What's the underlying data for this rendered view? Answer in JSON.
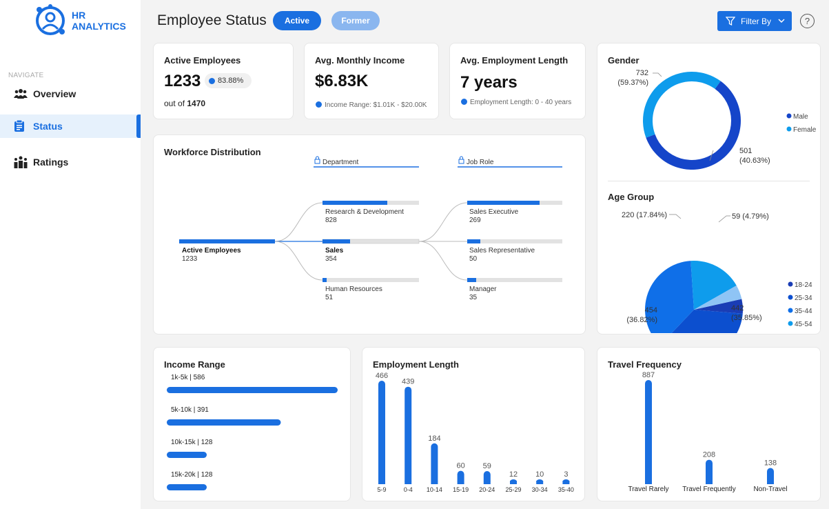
{
  "brand": {
    "line1": "HR",
    "line2": "ANALYTICS"
  },
  "nav": {
    "heading": "NAVIGATE",
    "items": [
      {
        "label": "Overview",
        "icon": "people-icon"
      },
      {
        "label": "Status",
        "icon": "clipboard-icon"
      },
      {
        "label": "Ratings",
        "icon": "award-icon"
      }
    ]
  },
  "header": {
    "title": "Employee Status",
    "active_label": "Active",
    "former_label": "Former",
    "filter_label": "Filter By",
    "help_label": "?"
  },
  "colors": {
    "accent": "#1a6fe0",
    "former_pill": "#8ab6ef",
    "light_blue": "#0e9cec"
  },
  "kpis": {
    "active": {
      "title": "Active Employees",
      "value": "1233",
      "percent": "83.88%",
      "out_of_label": "out of",
      "out_of_value": "1470"
    },
    "income": {
      "title": "Avg. Monthly Income",
      "value": "$6.83K",
      "note": "Income Range: $1.01K - $20.00K"
    },
    "tenure": {
      "title": "Avg. Employment Length",
      "value": "7 years",
      "note": "Employment Length: 0 - 40 years"
    }
  },
  "workforce": {
    "title": "Workforce Distribution",
    "root": {
      "label": "Active Employees",
      "value": "1233"
    },
    "level1_header": "Department",
    "level2_header": "Job Role",
    "departments": [
      {
        "label": "Research & Development",
        "value": "828",
        "bold": false
      },
      {
        "label": "Sales",
        "value": "354",
        "bold": true
      },
      {
        "label": "Human Resources",
        "value": "51",
        "bold": false
      }
    ],
    "roles": [
      {
        "label": "Sales Executive",
        "value": "269"
      },
      {
        "label": "Sales Representative",
        "value": "50"
      },
      {
        "label": "Manager",
        "value": "35"
      }
    ]
  },
  "gender": {
    "title": "Gender",
    "male_label": "732",
    "male_pct": "(59.37%)",
    "female_label": "501",
    "female_pct": "(40.63%)",
    "legend": [
      "Male",
      "Female"
    ]
  },
  "age_group": {
    "title": "Age Group",
    "legend": [
      "18-24",
      "25-34",
      "35-44",
      "45-54",
      "55-60"
    ],
    "labels": [
      {
        "a": "220 (17.84%)"
      },
      {
        "a": "59 (4.79%)"
      },
      {
        "a": "454",
        "b": "(36.82%)"
      },
      {
        "a": "442",
        "b": "(35.85%)"
      }
    ]
  },
  "income_range": {
    "title": "Income Range"
  },
  "employment_length": {
    "title": "Employment Length"
  },
  "travel": {
    "title": "Travel Frequency"
  },
  "chart_data": [
    {
      "type": "pie",
      "title": "Gender",
      "categories": [
        "Male",
        "Female"
      ],
      "values": [
        732,
        501
      ],
      "percent": [
        59.37,
        40.63
      ]
    },
    {
      "type": "pie",
      "title": "Age Group",
      "categories": [
        "18-24",
        "25-34",
        "35-44",
        "45-54",
        "55-60"
      ],
      "values": [
        59,
        442,
        454,
        220,
        58
      ]
    },
    {
      "type": "bar",
      "title": "Income Range",
      "categories": [
        "1k-5k",
        "5k-10k",
        "10k-15k",
        "15k-20k"
      ],
      "values": [
        586,
        391,
        128,
        128
      ]
    },
    {
      "type": "bar",
      "title": "Employment Length",
      "categories": [
        "5-9",
        "0-4",
        "10-14",
        "15-19",
        "20-24",
        "25-29",
        "30-34",
        "35-40"
      ],
      "values": [
        466,
        439,
        184,
        60,
        59,
        12,
        10,
        3
      ]
    },
    {
      "type": "bar",
      "title": "Travel Frequency",
      "categories": [
        "Travel Rarely",
        "Travel Frequently",
        "Non-Travel"
      ],
      "values": [
        887,
        208,
        138
      ]
    }
  ]
}
